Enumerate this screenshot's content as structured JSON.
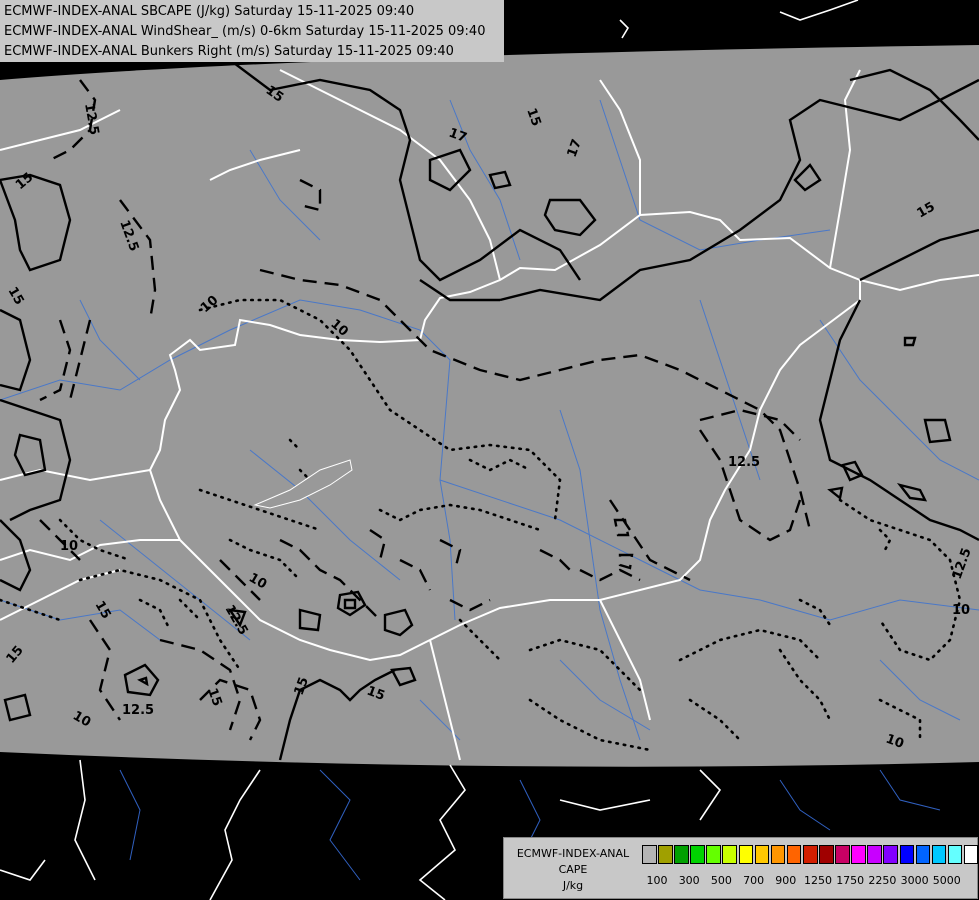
{
  "header": {
    "line1": "ECMWF-INDEX-ANAL SBCAPE (J/kg) Saturday 15-11-2025 09:40",
    "line2": "ECMWF-INDEX-ANAL WindShear_ (m/s) 0-6km Saturday 15-11-2025 09:40",
    "line3": "ECMWF-INDEX-ANAL Bunkers Right (m/s) Saturday 15-11-2025 09:40"
  },
  "legend": {
    "title": "ECMWF-INDEX-ANAL",
    "field": "CAPE",
    "unit": "J/kg",
    "colors": [
      "#b4b4b4",
      "#a0a000",
      "#00a000",
      "#00d200",
      "#64ff00",
      "#c8ff00",
      "#ffff00",
      "#ffc800",
      "#ff9600",
      "#ff6400",
      "#d21e00",
      "#a00000",
      "#c80064",
      "#ff00ff",
      "#c800ff",
      "#8200ff",
      "#0000ff",
      "#0064ff",
      "#00c8ff",
      "#64ffff",
      "#ffffff"
    ],
    "ticks": [
      "100",
      "300",
      "500",
      "700",
      "900",
      "1250",
      "1750",
      "2250",
      "3000",
      "5000"
    ]
  },
  "contour_labels": {
    "l1": "12.5",
    "l2": "15",
    "l3": "17",
    "l4": "15",
    "l5": "17",
    "l6": "12.5",
    "l7": "15",
    "l8": "15",
    "l9": "10",
    "l10": "10",
    "l11": "12.5",
    "l12": "15",
    "l13": "10",
    "l14": "10",
    "l15": "12.5",
    "l16": "15",
    "l17": "15",
    "l18": "15",
    "l19": "10",
    "l20": "12.5",
    "l21": "10",
    "l22": "10",
    "l23": "15",
    "l24": "15",
    "l25": "12.5"
  }
}
